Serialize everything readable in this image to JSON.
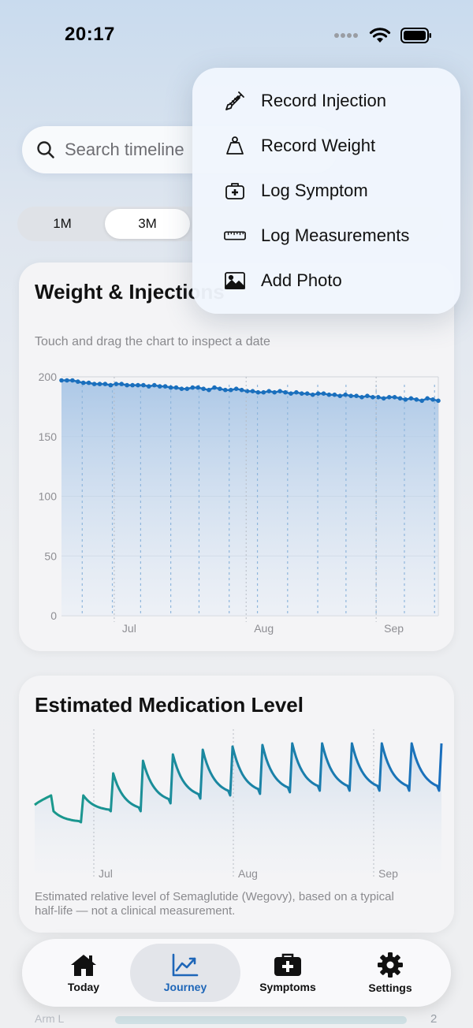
{
  "status_bar": {
    "time": "20:17"
  },
  "search": {
    "placeholder": "Search timeline"
  },
  "range_tabs": {
    "labels": [
      "1M",
      "3M"
    ],
    "active": "3M"
  },
  "weight_card": {
    "title": "Weight & Injections",
    "subtitle": "Touch and drag the chart to inspect a date"
  },
  "medication_card": {
    "title": "Estimated Medication Level",
    "footnote_line1": "Estimated relative level of Semaglutide (Wegovy), based on a typical",
    "footnote_line2": "half-life — not a clinical measurement."
  },
  "menu": {
    "items": [
      {
        "label": "Record Injection",
        "icon": "syringe-icon"
      },
      {
        "label": "Record Weight",
        "icon": "scale-weight-icon"
      },
      {
        "label": "Log Symptom",
        "icon": "medical-kit-icon"
      },
      {
        "label": "Log Measurements",
        "icon": "ruler-icon"
      },
      {
        "label": "Add Photo",
        "icon": "photo-icon"
      }
    ]
  },
  "tabbar": {
    "items": [
      {
        "label": "Today",
        "icon": "house-icon"
      },
      {
        "label": "Journey",
        "icon": "chart-trend-icon",
        "active": true
      },
      {
        "label": "Symptoms",
        "icon": "medical-kit-icon"
      },
      {
        "label": "Settings",
        "icon": "gear-icon"
      }
    ]
  },
  "peek_row": {
    "label": "Arm L",
    "value": "2"
  },
  "colors": {
    "accent": "#1e66b8",
    "weight_line": "#1a6fbd",
    "medication_line_start": "#1a9a8a",
    "medication_line_end": "#1a6fbd"
  },
  "chart_data": [
    {
      "type": "line",
      "title": "Weight & Injections",
      "ylim": [
        0,
        200
      ],
      "yticks": [
        "200",
        "150",
        "100",
        "50",
        "0"
      ],
      "xticks": [
        "Jul",
        "Aug",
        "Sep"
      ],
      "grid": true,
      "series": [
        {
          "values": [
            197,
            197,
            197,
            196,
            195,
            195,
            194,
            194,
            194,
            193,
            194,
            194,
            193,
            193,
            193,
            193,
            192,
            193,
            192,
            192,
            191,
            191,
            190,
            190,
            191,
            191,
            190,
            189,
            191,
            190,
            189,
            189,
            190,
            189,
            188,
            188,
            187,
            187,
            188,
            187,
            188,
            187,
            186,
            187,
            186,
            186,
            185,
            186,
            186,
            185,
            185,
            184,
            185,
            184,
            184,
            183,
            184,
            183,
            183,
            182,
            183,
            183,
            182,
            181,
            182,
            181,
            180,
            182,
            181,
            180
          ]
        }
      ]
    },
    {
      "type": "line",
      "title": "Estimated Medication Level",
      "xticks": [
        "Jul",
        "Aug",
        "Sep"
      ],
      "series": [
        {
          "peaks": [
            0.3,
            0.4,
            0.54,
            0.62,
            0.66,
            0.69,
            0.71,
            0.72,
            0.73,
            0.73,
            0.73,
            0.73,
            0.73,
            0.73
          ],
          "troughs": [
            0.4,
            0.23,
            0.3,
            0.3,
            0.35,
            0.38,
            0.4,
            0.41,
            0.42,
            0.43,
            0.43,
            0.43,
            0.43,
            0.43
          ]
        }
      ]
    }
  ]
}
